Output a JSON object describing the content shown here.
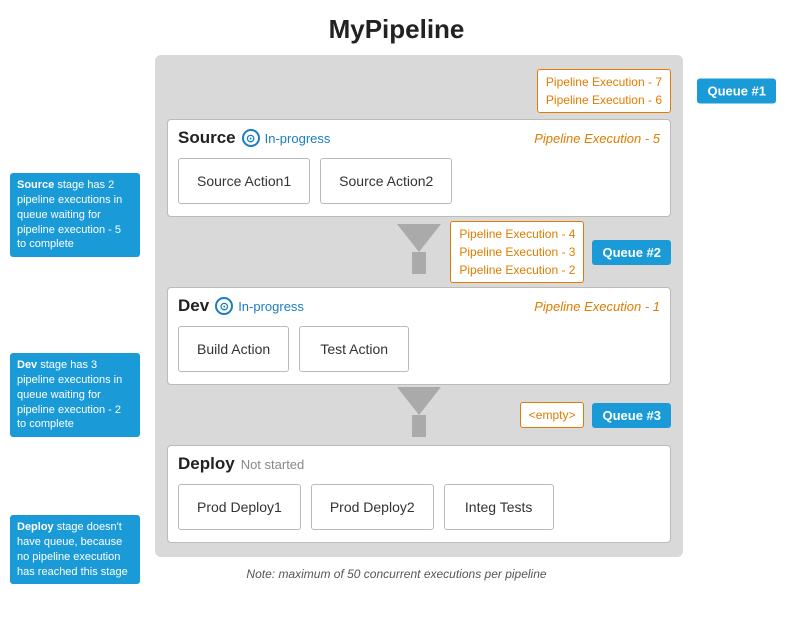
{
  "title": "MyPipeline",
  "pipeline": {
    "stages": [
      {
        "name": "Source",
        "status": "In-progress",
        "execution": "Pipeline Execution  -  5",
        "actions": [
          "Source Action1",
          "Source Action2"
        ]
      },
      {
        "name": "Dev",
        "status": "In-progress",
        "execution": "Pipeline Execution  -  1",
        "actions": [
          "Build Action",
          "Test Action"
        ]
      },
      {
        "name": "Deploy",
        "status": "Not started",
        "execution": "",
        "actions": [
          "Prod Deploy1",
          "Prod Deploy2",
          "Integ Tests"
        ]
      }
    ],
    "queues": [
      {
        "id": "Queue #1",
        "executions": [
          "Pipeline Execution - 7",
          "Pipeline Execution - 6"
        ]
      },
      {
        "id": "Queue #2",
        "executions": [
          "Pipeline Execution - 4",
          "Pipeline Execution - 3",
          "Pipeline Execution - 2"
        ]
      },
      {
        "id": "Queue #3",
        "executions": [
          "<empty>"
        ]
      }
    ],
    "sidebar_notes": [
      {
        "id": "note-source",
        "text": "Source stage has 2 pipeline executions in queue waiting for pipeline execution - 5 to complete"
      },
      {
        "id": "note-dev",
        "text": "Dev stage has 3 pipeline executions in queue waiting for pipeline execution - 2 to complete"
      },
      {
        "id": "note-deploy",
        "text": "Deploy stage doesn't have queue, because no pipeline execution has reached this stage"
      }
    ],
    "footer_note": "Note:  maximum of 50 concurrent executions  per pipeline"
  }
}
